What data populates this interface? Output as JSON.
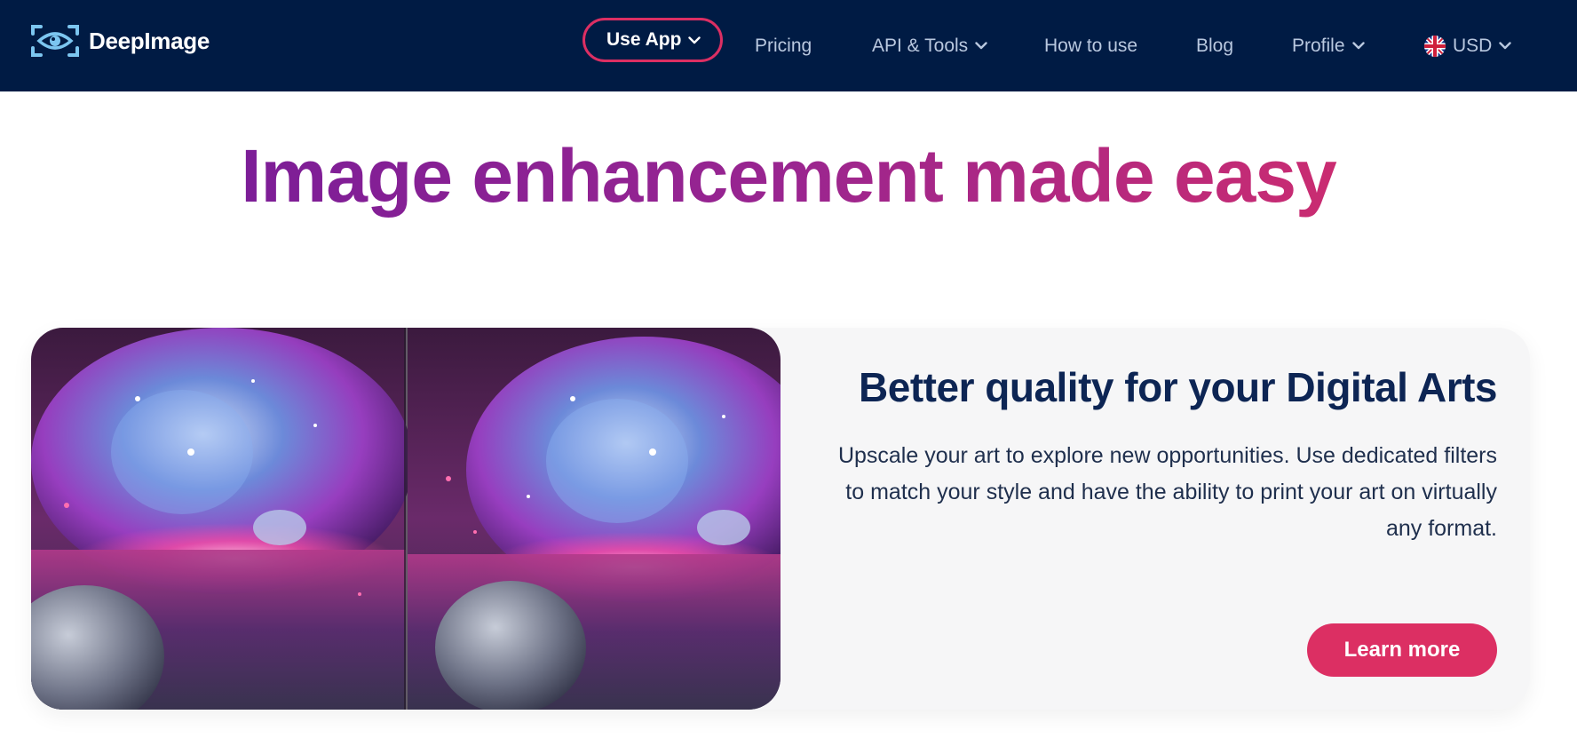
{
  "header": {
    "brand": "DeepImage",
    "nav": [
      {
        "label": "Use App",
        "active": true,
        "dropdown": true
      },
      {
        "label": "Pricing",
        "active": false,
        "dropdown": false
      },
      {
        "label": "API & Tools",
        "active": false,
        "dropdown": true
      },
      {
        "label": "How to use",
        "active": false,
        "dropdown": false
      },
      {
        "label": "Blog",
        "active": false,
        "dropdown": false
      },
      {
        "label": "Profile",
        "active": false,
        "dropdown": true
      },
      {
        "label": "USD",
        "active": false,
        "dropdown": true,
        "icon": "uk-flag-icon"
      }
    ]
  },
  "hero": {
    "title": "Image enhancement made easy"
  },
  "feature_card": {
    "image": "digital-art-comparison-image",
    "title": "Better quality for your Digital Arts",
    "description": "Upscale your art to explore new opportunities. Use dedicated filters to match your style and have the ability to print your art on virtually any format.",
    "button_label": "Learn more"
  },
  "colors": {
    "header_bg": "#001b44",
    "accent": "#dc2f63",
    "title_gradient_start": "#6f1a9a",
    "title_gradient_end": "#df2f63",
    "card_bg": "#f6f6f7",
    "card_title": "#0d2554"
  }
}
